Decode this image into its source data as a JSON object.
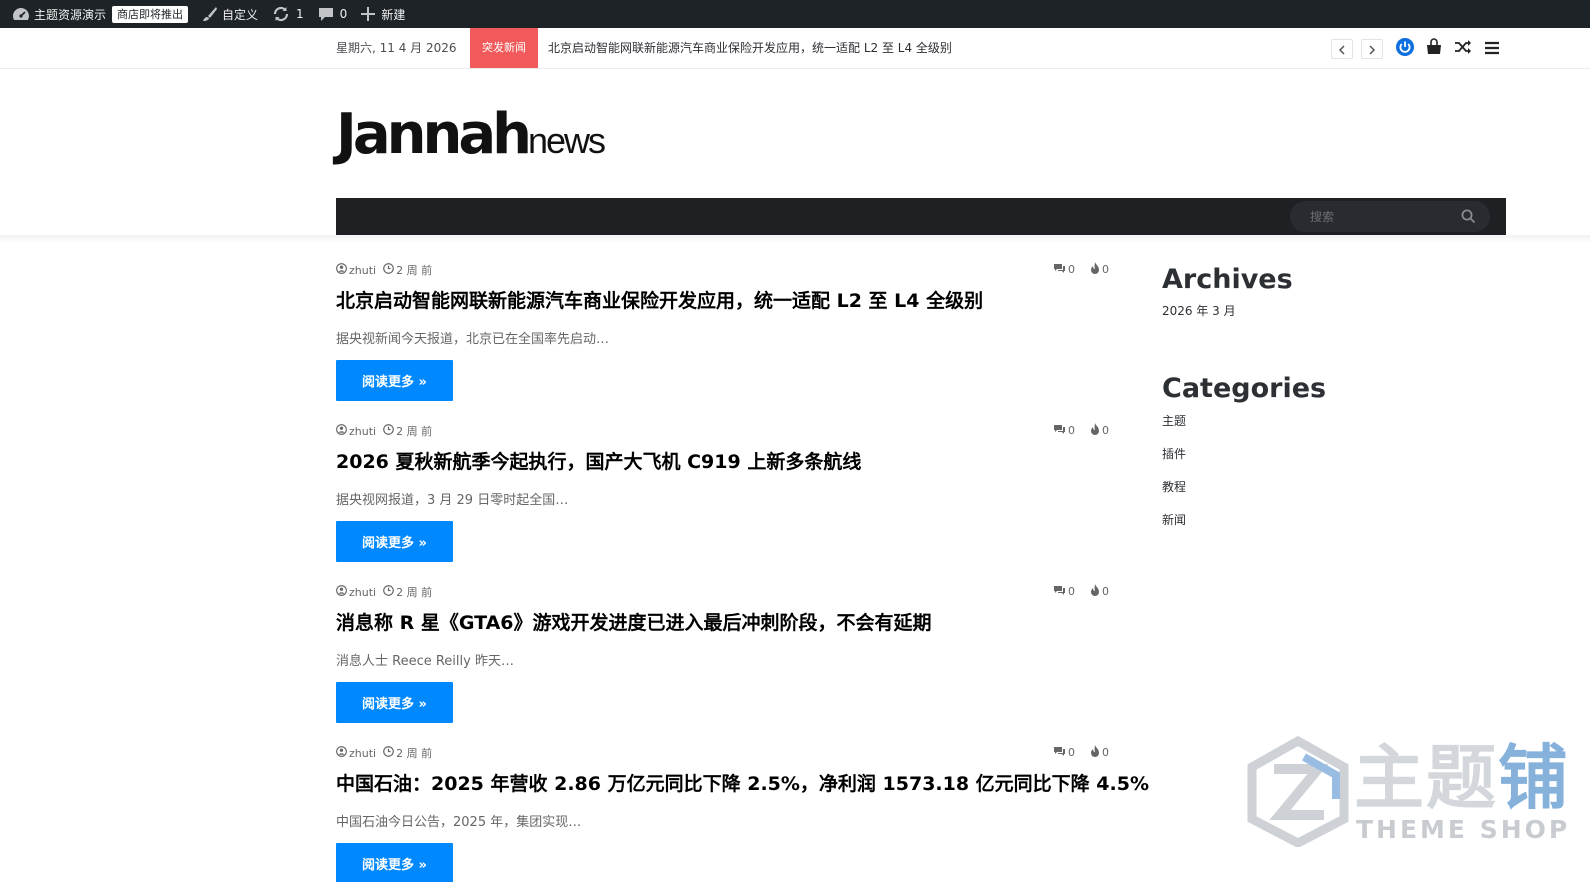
{
  "adminbar": {
    "site_name": "主题资源演示",
    "store_badge": "商店即将推出",
    "customize": "自定义",
    "updates_count": "1",
    "comments_count": "0",
    "new_label": "新建"
  },
  "topbar": {
    "date": "星期六, 11 4 月 2026",
    "breaking_label": "突发新闻",
    "breaking_text": "北京启动智能网联新能源汽车商业保险开发应用，统一适配 L2 至 L4 全级别"
  },
  "logo": {
    "main": "Jannah",
    "sub": "news"
  },
  "search": {
    "placeholder": "搜索"
  },
  "posts": [
    {
      "author": "zhuti",
      "time": "2 周 前",
      "comments": "0",
      "views": "0",
      "title": "北京启动智能网联新能源汽车商业保险开发应用，统一适配 L2 至 L4 全级别",
      "excerpt": "据央视新闻今天报道，北京已在全国率先启动…",
      "read_more": "阅读更多 »"
    },
    {
      "author": "zhuti",
      "time": "2 周 前",
      "comments": "0",
      "views": "0",
      "title": "2026 夏秋新航季今起执行，国产大飞机 C919 上新多条航线",
      "excerpt": "据央视网报道，3 月 29 日零时起全国…",
      "read_more": "阅读更多 »"
    },
    {
      "author": "zhuti",
      "time": "2 周 前",
      "comments": "0",
      "views": "0",
      "title": "消息称 R 星《GTA6》游戏开发进度已进入最后冲刺阶段，不会有延期",
      "excerpt": "消息人士 Reece Reilly 昨天…",
      "read_more": "阅读更多 »"
    },
    {
      "author": "zhuti",
      "time": "2 周 前",
      "comments": "0",
      "views": "0",
      "title": "中国石油：2025 年营收 2.86 万亿元同比下降 2.5%，净利润 1573.18 亿元同比下降 4.5%",
      "excerpt": "中国石油今日公告，2025 年，集团实现…",
      "read_more": "阅读更多 »"
    }
  ],
  "sidebar": {
    "archives_title": "Archives",
    "archives": [
      "2026 年 3 月"
    ],
    "categories_title": "Categories",
    "categories": [
      "主题",
      "插件",
      "教程",
      "新闻"
    ]
  },
  "watermark": {
    "cn_gray": "主题",
    "cn_blue": "铺",
    "en": "THEME SHOP"
  },
  "colors": {
    "accent": "#0088ff",
    "breaking": "#f05a5a",
    "nav_dark": "#1f2024",
    "adminbar": "#1d2327"
  }
}
